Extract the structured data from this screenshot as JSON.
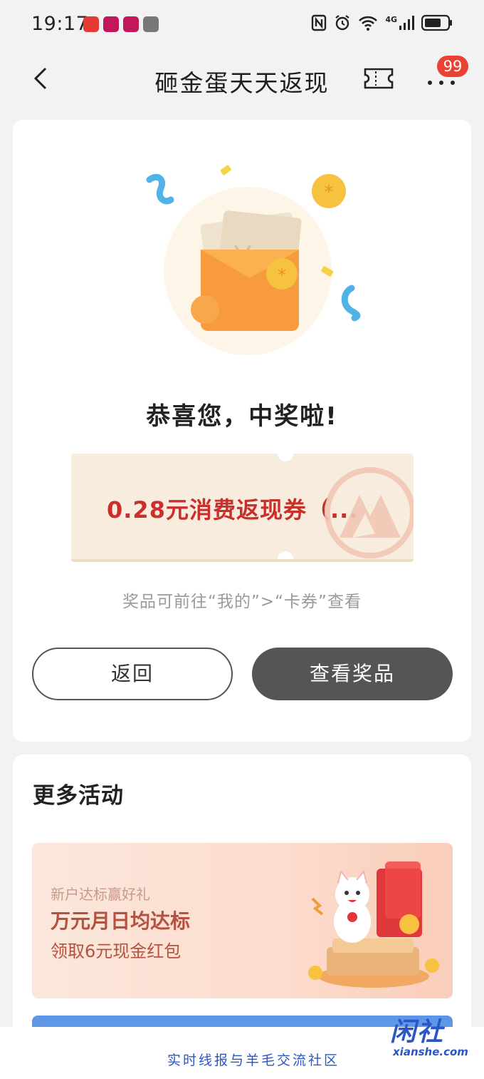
{
  "status": {
    "time": "19:17",
    "network": "4G",
    "app_icons": [
      "cmb-app-icon",
      "tmall-icon",
      "tmall-icon",
      "game-icon"
    ]
  },
  "header": {
    "title": "砸金蛋天天返现",
    "badge_count": "99",
    "icons": [
      "back-arrow-icon",
      "ticket-icon",
      "more-dots-icon"
    ]
  },
  "result": {
    "congrats": "恭喜您，中奖啦!",
    "coupon_label": "0.28元消费返现券（...",
    "hint": "奖品可前往“我的”>“卡券”查看",
    "back_label": "返回",
    "view_label": "查看奖品"
  },
  "more": {
    "section_title": "更多活动",
    "promo": {
      "subtitle": "新户达标赢好礼",
      "title": "万元月日均达标",
      "desc": "领取6元现金红包"
    }
  },
  "watermark": {
    "logo": "闲社",
    "url": "xianshe.com",
    "footer": "实时线报与羊毛交流社区"
  },
  "colors": {
    "accent_red": "#c9302c",
    "badge_red": "#e94235",
    "button_dark": "#555555",
    "coupon_bg": "#f8ecde",
    "watermark_blue": "#2a56c6"
  }
}
